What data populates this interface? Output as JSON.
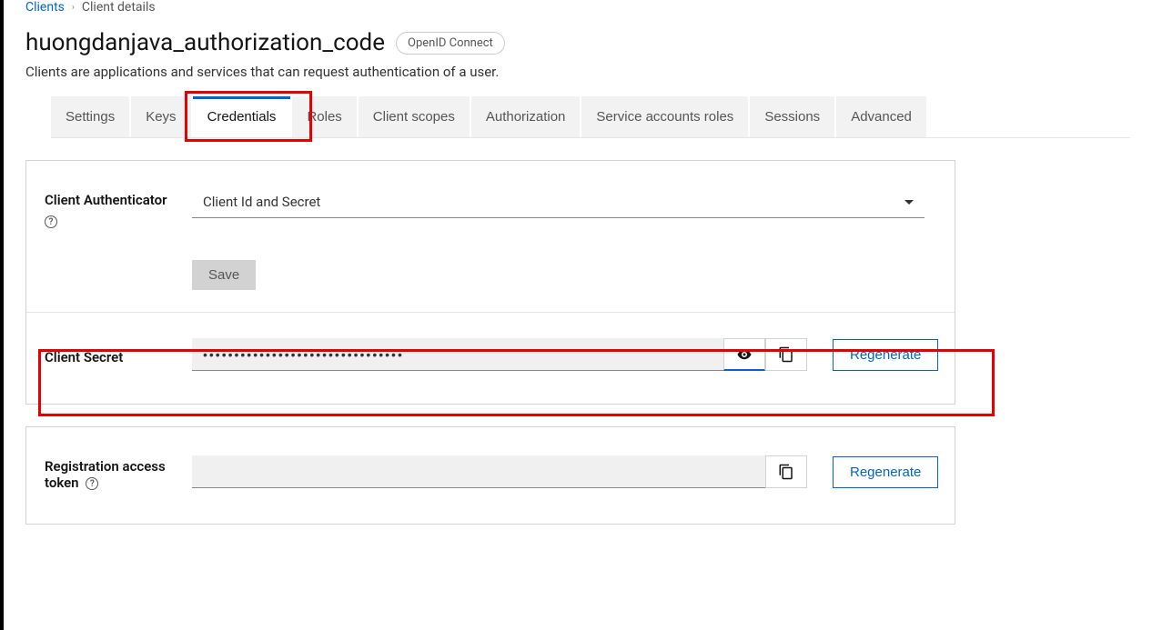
{
  "breadcrumb": {
    "root": "Clients",
    "current": "Client details"
  },
  "title": "huongdanjava_authorization_code",
  "badge": "OpenID Connect",
  "subtitle": "Clients are applications and services that can request authentication of a user.",
  "tabs": {
    "settings": "Settings",
    "keys": "Keys",
    "credentials": "Credentials",
    "roles": "Roles",
    "client_scopes": "Client scopes",
    "authorization": "Authorization",
    "service_accounts": "Service accounts roles",
    "sessions": "Sessions",
    "advanced": "Advanced"
  },
  "form": {
    "authenticator_label": "Client Authenticator",
    "authenticator_value": "Client Id and Secret",
    "save": "Save"
  },
  "secret": {
    "label": "Client Secret",
    "masked": "••••••••••••••••••••••••••••••••",
    "regenerate": "Regenerate"
  },
  "token": {
    "label": "Registration access token",
    "value": "",
    "regenerate": "Regenerate"
  }
}
